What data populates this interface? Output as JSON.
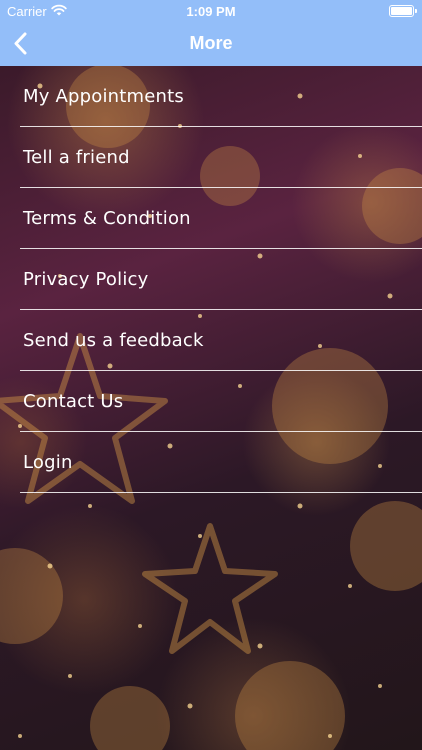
{
  "status_bar": {
    "carrier": "Carrier",
    "time": "1:09 PM"
  },
  "header": {
    "title": "More",
    "back_icon": "chevron-left-icon",
    "background_color": "#93bef9"
  },
  "menu": {
    "items": [
      {
        "label": "My Appointments"
      },
      {
        "label": "Tell a friend"
      },
      {
        "label": "Terms & Condition"
      },
      {
        "label": "Privacy Policy"
      },
      {
        "label": "Send us a feedback"
      },
      {
        "label": "Contact Us"
      },
      {
        "label": "Login"
      }
    ]
  }
}
